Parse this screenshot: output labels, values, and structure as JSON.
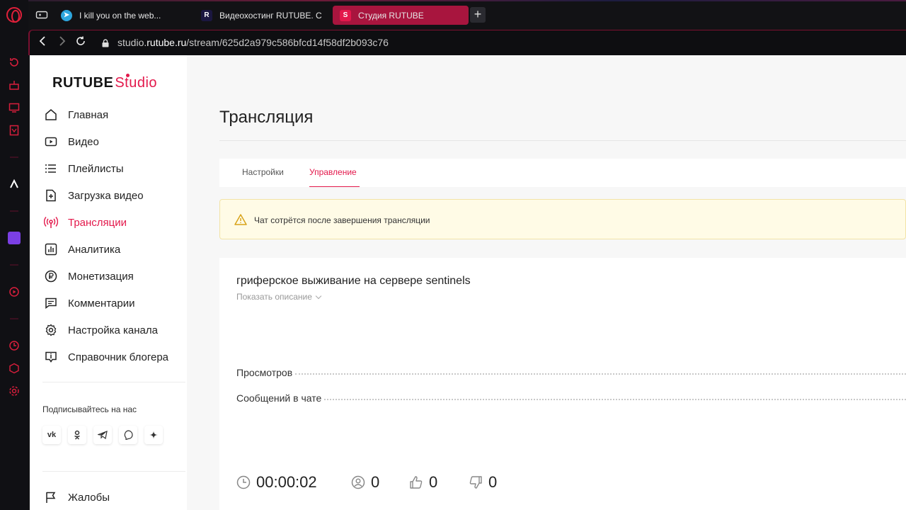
{
  "browser": {
    "tabs": [
      {
        "title": "I kill you on the web...",
        "icon": "telegram-icon",
        "active": false
      },
      {
        "title": "Видеохостинг RUTUBE. С",
        "icon": "rutube-icon",
        "active": false
      },
      {
        "title": "Студия RUTUBE",
        "icon": "studio-icon",
        "active": true
      }
    ],
    "new_tab": "+",
    "url_prefix": "studio.",
    "url_domain": "rutube.ru",
    "url_path": "/stream/625d2a979c586bfcd14f58df2b093c76",
    "colors": {
      "active_tab": "#a8153e",
      "accent": "#e0203a"
    }
  },
  "sidebar": {
    "logo_main": "RUTUBE",
    "logo_studio": "Studio",
    "items": [
      {
        "label": "Главная",
        "icon": "home-icon"
      },
      {
        "label": "Видео",
        "icon": "video-icon"
      },
      {
        "label": "Плейлисты",
        "icon": "playlist-icon"
      },
      {
        "label": "Загрузка видео",
        "icon": "upload-icon"
      },
      {
        "label": "Трансляции",
        "icon": "broadcast-icon",
        "active": true
      },
      {
        "label": "Аналитика",
        "icon": "analytics-icon"
      },
      {
        "label": "Монетизация",
        "icon": "ruble-icon"
      },
      {
        "label": "Комментарии",
        "icon": "comments-icon"
      },
      {
        "label": "Настройка канала",
        "icon": "gear-icon"
      },
      {
        "label": "Справочник блогера",
        "icon": "info-icon"
      }
    ],
    "follow_label": "Подписывайтесь на нас",
    "social": [
      "vk-icon",
      "ok-icon",
      "telegram-icon",
      "viber-icon",
      "dzen-icon"
    ],
    "complaints": "Жалобы"
  },
  "main": {
    "title": "Трансляция",
    "tabs": [
      "Настройки",
      "Управление"
    ],
    "active_tab": "Управление",
    "warning": "Чат сотрётся после завершения трансляции",
    "stream_title": "гриферское выживание на сервере sentinels",
    "show_description": "Показать описание",
    "stats": [
      {
        "label": "Просмотров"
      },
      {
        "label": "Сообщений в чате"
      }
    ],
    "counters": {
      "duration": "00:00:02",
      "viewers": "0",
      "likes": "0",
      "dislikes": "0"
    },
    "accent": "#e3184b"
  }
}
